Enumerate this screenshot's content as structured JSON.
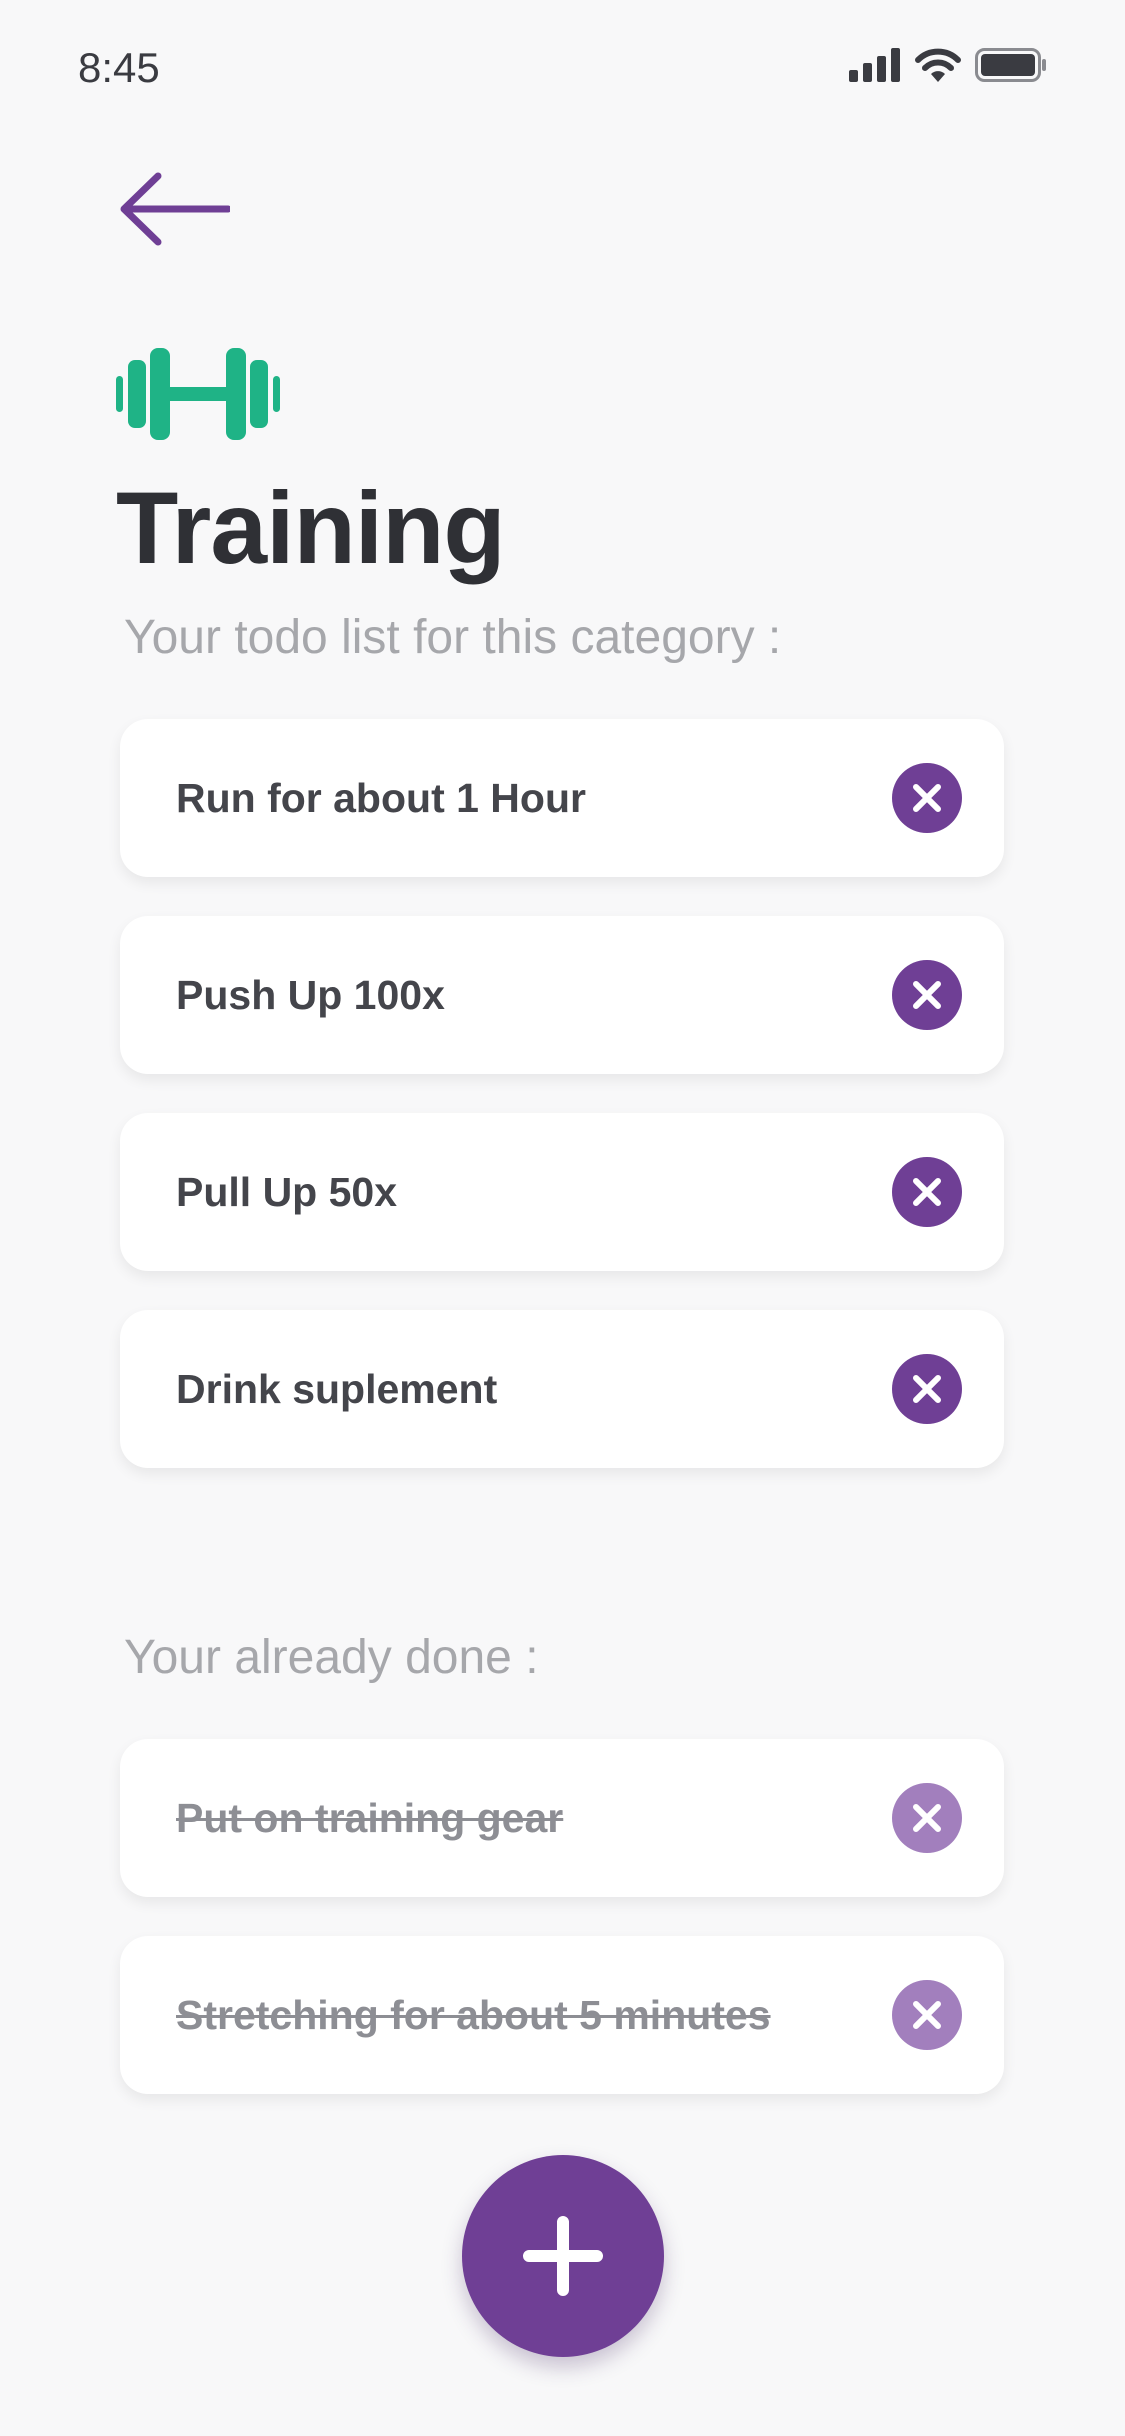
{
  "status_bar": {
    "time": "8:45",
    "icons": [
      "signal-icon",
      "wifi-icon",
      "battery-icon"
    ]
  },
  "nav": {
    "back_icon": "arrow-left-icon"
  },
  "category": {
    "icon": "dumbbell-icon",
    "title": "Training"
  },
  "todo_section": {
    "label": "Your todo list for this category :",
    "items": [
      {
        "label": "Run for about 1 Hour"
      },
      {
        "label": "Push Up 100x"
      },
      {
        "label": "Pull Up 50x"
      },
      {
        "label": "Drink suplement"
      }
    ]
  },
  "done_section": {
    "label": "Your already done :",
    "items": [
      {
        "label": "Put on training gear"
      },
      {
        "label": "Stretching for about 5 minutes"
      }
    ]
  },
  "fab": {
    "icon": "plus-icon"
  },
  "colors": {
    "accent": "#6f3f95",
    "accent_light": "#a27fbd",
    "category_icon": "#1fb386",
    "background": "#f8f8f9"
  }
}
